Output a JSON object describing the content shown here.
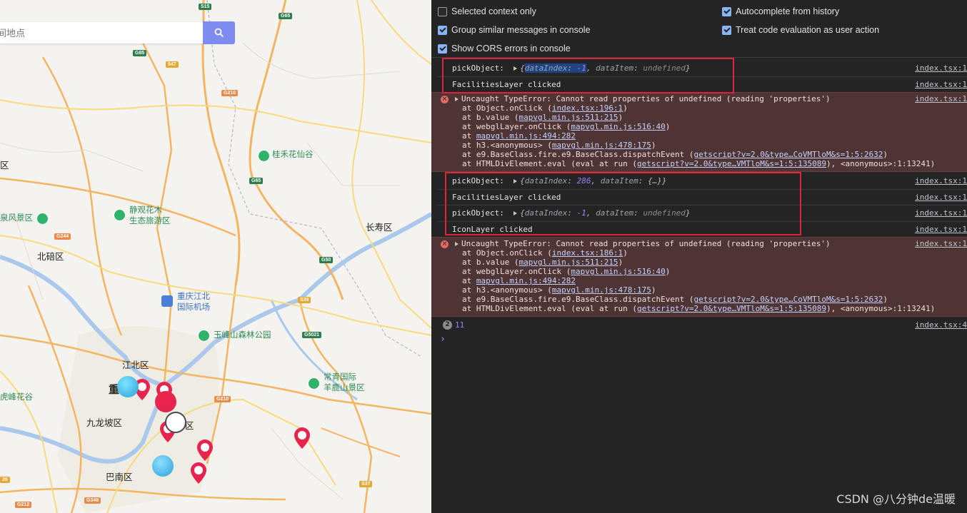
{
  "map": {
    "search": {
      "placeholder": "间地点"
    },
    "labels": {
      "beibei": "北碚区",
      "changshou": "长寿区",
      "jiangbei": "江北区",
      "jiulongpo": "九龙坡区",
      "banan": "巴南区",
      "nan_an_suffix": "区",
      "chong": "重",
      "qu_left": "区",
      "fengjing": "泉风景区",
      "guihe": "桂禾花仙谷",
      "jingguan_1": "静观花木",
      "jingguan_2": "生态旅游区",
      "airport_1": "重庆江北",
      "airport_2": "国际机场",
      "yufeng": "玉峰山森林公园",
      "changqing_1": "常青国际",
      "changqing_2": "羊鹿山景区",
      "hufeng": "虎峰花谷"
    },
    "roads": {
      "s15": "S15",
      "g65a": "G65",
      "g85": "G85",
      "s47": "547",
      "g210a": "G210",
      "g65b": "G65",
      "g244": "G244",
      "g50": "G50",
      "s39": "S39",
      "g5021": "G5021",
      "g210b": "G210",
      "s37": "S37",
      "g348": "G348",
      "g212": "G212",
      "s26": "26"
    }
  },
  "devtools": {
    "settings": {
      "selected_context": {
        "label": "Selected context only",
        "checked": false
      },
      "group_similar": {
        "label": "Group similar messages in console",
        "checked": true
      },
      "show_cors": {
        "label": "Show CORS errors in console",
        "checked": true
      },
      "autocomplete": {
        "label": "Autocomplete from history",
        "checked": true
      },
      "treat_eval": {
        "label": "Treat code evaluation as user action",
        "checked": true
      }
    },
    "messages": {
      "m1": {
        "prefix": "pickObject:",
        "k1": "dataIndex",
        "v1": "-1",
        "k2": "dataItem",
        "v2": "undefined",
        "src": "index.tsx:1"
      },
      "m2": {
        "text": "FacilitiesLayer clicked",
        "src": "index.tsx:1"
      },
      "e1": {
        "head": "Uncaught TypeError: Cannot read properties of undefined (reading 'properties')",
        "src": "index.tsx:1",
        "l1_a": "at Object.onClick (",
        "l1_link": "index.tsx:196:1",
        "l1_b": ")",
        "l2_a": "at b.value (",
        "l2_link": "mapvgl.min.js:511:215",
        "l2_b": ")",
        "l3_a": "at webglLayer.onClick (",
        "l3_link": "mapvgl.min.js:516:40",
        "l3_b": ")",
        "l4_a": "at ",
        "l4_link": "mapvgl.min.js:494:282",
        "l5_a": "at h3.<anonymous> (",
        "l5_link": "mapvgl.min.js:478:175",
        "l5_b": ")",
        "l6_a": "at e9.BaseClass.fire.e9.BaseClass.dispatchEvent (",
        "l6_link": "getscript?v=2.0&type…CoVMTloM&s=1:5:2632",
        "l6_b": ")",
        "l7_a": "at HTMLDivElement.eval (eval at run (",
        "l7_link": "getscript?v=2.0&type…VMTloM&s=1:5:135089",
        "l7_b": "), <anonymous>:1:13241)"
      },
      "m3": {
        "prefix": "pickObject:",
        "k1": "dataIndex",
        "v1": "286",
        "k2": "dataItem",
        "v2": "{…}",
        "src": "index.tsx:1"
      },
      "m4": {
        "text": "FacilitiesLayer clicked",
        "src": "index.tsx:1"
      },
      "m5": {
        "prefix": "pickObject:",
        "k1": "dataIndex",
        "v1": "-1",
        "k2": "dataItem",
        "v2": "undefined",
        "src": "index.tsx:1"
      },
      "m6": {
        "text": "IconLayer clicked",
        "src": "index.tsx:1"
      },
      "e2": {
        "head": "Uncaught TypeError: Cannot read properties of undefined (reading 'properties')",
        "src": "index.tsx:1",
        "l1_a": "at Object.onClick (",
        "l1_link": "index.tsx:186:1",
        "l1_b": ")",
        "l2_a": "at b.value (",
        "l2_link": "mapvgl.min.js:511:215",
        "l2_b": ")",
        "l3_a": "at webglLayer.onClick (",
        "l3_link": "mapvgl.min.js:516:40",
        "l3_b": ")",
        "l4_a": "at ",
        "l4_link": "mapvgl.min.js:494:282",
        "l5_a": "at h3.<anonymous> (",
        "l5_link": "mapvgl.min.js:478:175",
        "l5_b": ")",
        "l6_a": "at e9.BaseClass.fire.e9.BaseClass.dispatchEvent (",
        "l6_link": "getscript?v=2.0&type…CoVMTloM&s=1:5:2632",
        "l6_b": ")",
        "l7_a": "at HTMLDivElement.eval (eval at run (",
        "l7_link": "getscript?v=2.0&type…VMTloM&s=1:5:135089",
        "l7_b": "), <anonymous>:1:13241)"
      },
      "count": {
        "badge": "2",
        "value": "11",
        "src": "index.tsx:4"
      }
    },
    "prompt": "›"
  },
  "watermark": "CSDN @八分钟de温暖",
  "colors": {
    "highlight_box": "#e0243c",
    "error_bg": "#4e3534",
    "checkbox": "#8ab4f8",
    "search_button": "#7e8cf2",
    "marker": "#e6244e"
  }
}
